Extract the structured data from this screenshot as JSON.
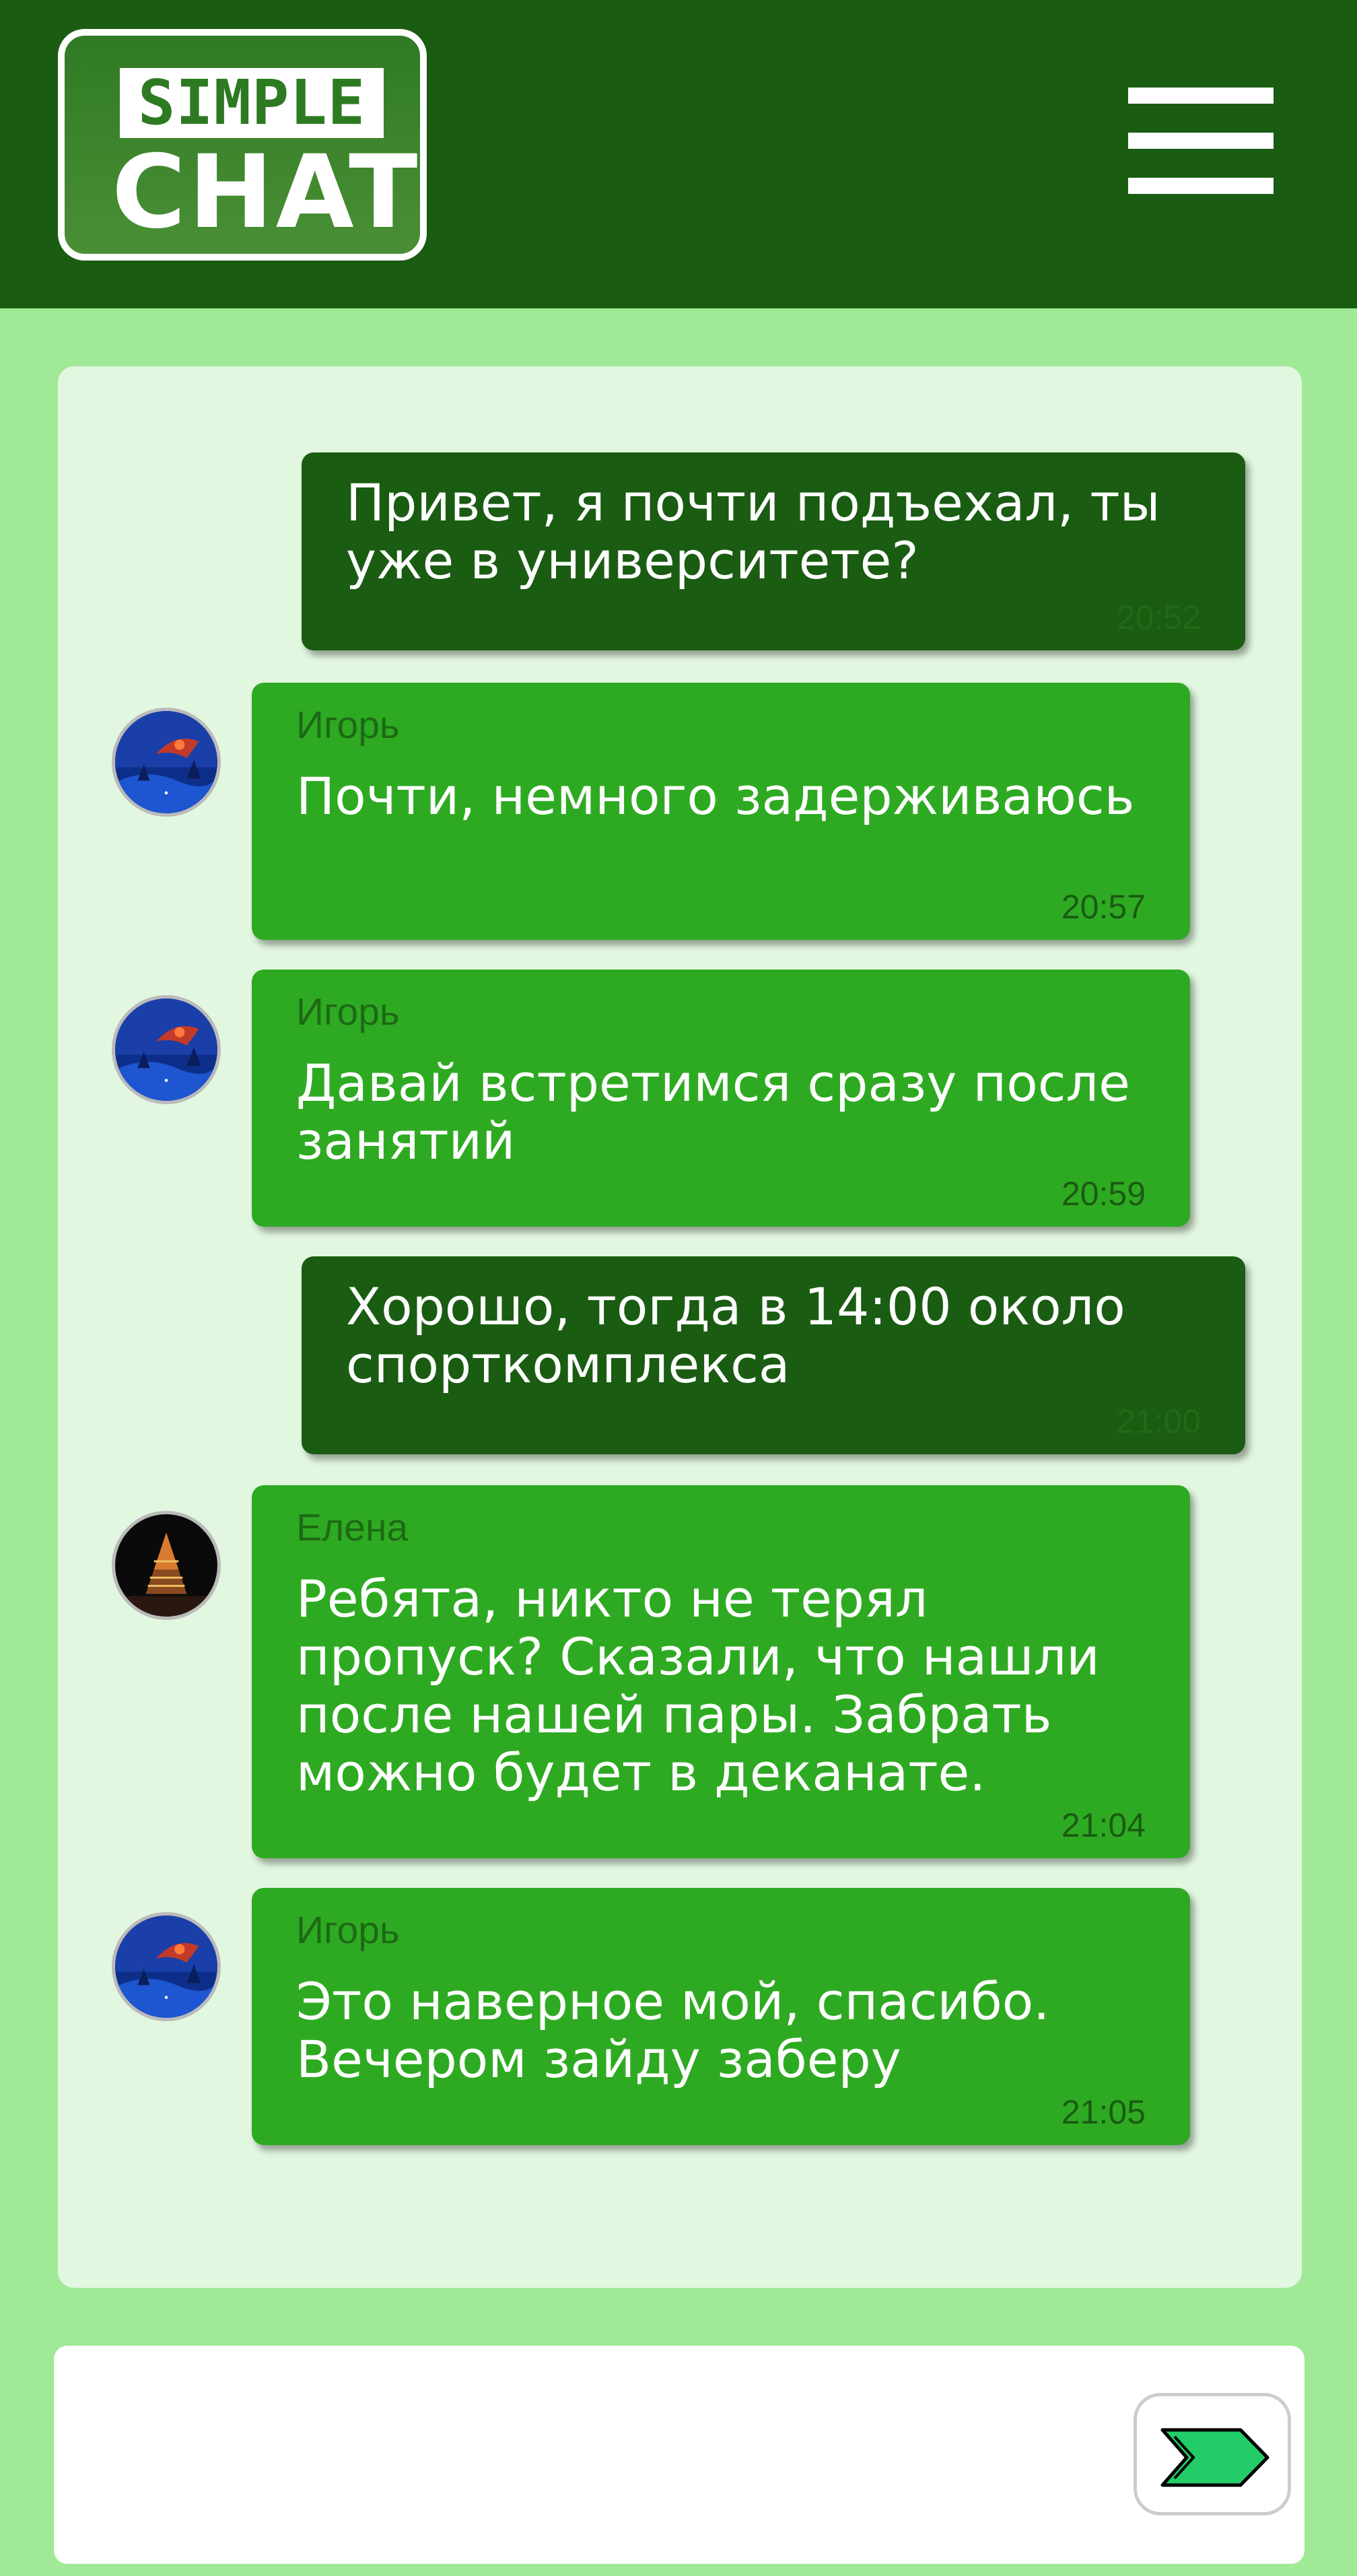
{
  "header": {
    "logo_top": "SIMPLE",
    "logo_bottom": "CHAT",
    "menu_icon": "hamburger-menu-icon"
  },
  "colors": {
    "header_bg": "#1a5c12",
    "page_bg": "#a0e996",
    "panel_bg": "#e2f7e0",
    "outgoing_bubble": "#1a5c12",
    "incoming_bubble": "#2eaa22",
    "send_arrow": "#22cc66"
  },
  "messages": [
    {
      "direction": "outgoing",
      "text": "Привет, я почти подъехал, ты уже в университете?",
      "time": "20:52"
    },
    {
      "direction": "incoming",
      "sender": "Игорь",
      "avatar": "winter-night-avatar",
      "text": "Почти, немного задерживаюсь",
      "time": "20:57"
    },
    {
      "direction": "incoming",
      "sender": "Игорь",
      "avatar": "winter-night-avatar",
      "text": "Давай встретимся сразу после занятий",
      "time": "20:59"
    },
    {
      "direction": "outgoing",
      "text": "Хорошо, тогда в 14:00 около спорткомплекса",
      "time": "21:00"
    },
    {
      "direction": "incoming",
      "sender": "Елена",
      "avatar": "christmas-tree-avatar",
      "text": "Ребята, никто не терял пропуск? Сказали, что нашли после нашей пары. Забрать можно будет в деканате.",
      "time": "21:04"
    },
    {
      "direction": "incoming",
      "sender": "Игорь",
      "avatar": "winter-night-avatar",
      "text": "Это наверное мой, спасибо. Вечером зайду заберу",
      "time": "21:05"
    }
  ],
  "composer": {
    "value": "",
    "placeholder": "",
    "send_icon": "send-arrow-icon"
  }
}
